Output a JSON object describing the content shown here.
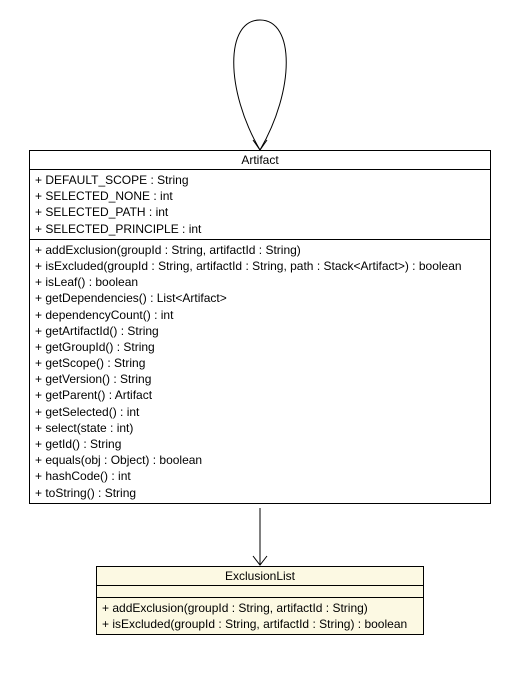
{
  "artifact": {
    "name": "Artifact",
    "attributes": [
      "+ DEFAULT_SCOPE : String",
      "+ SELECTED_NONE : int",
      "+ SELECTED_PATH : int",
      "+ SELECTED_PRINCIPLE : int"
    ],
    "methods": [
      "+ addExclusion(groupId : String, artifactId : String)",
      "+ isExcluded(groupId : String, artifactId : String, path : Stack<Artifact>) : boolean",
      "+ isLeaf() : boolean",
      "+ getDependencies() : List<Artifact>",
      "+ dependencyCount() : int",
      "+ getArtifactId() : String",
      "+ getGroupId() : String",
      "+ getScope() : String",
      "+ getVersion() : String",
      "+ getParent() : Artifact",
      "+ getSelected() : int",
      "+ select(state : int)",
      "+ getId() : String",
      "+ equals(obj : Object) : boolean",
      "+ hashCode() : int",
      "+ toString() : String"
    ]
  },
  "exclusionList": {
    "name": "ExclusionList",
    "methods": [
      "+ addExclusion(groupId : String, artifactId : String)",
      "+ isExcluded(groupId : String, artifactId : String) : boolean"
    ]
  }
}
